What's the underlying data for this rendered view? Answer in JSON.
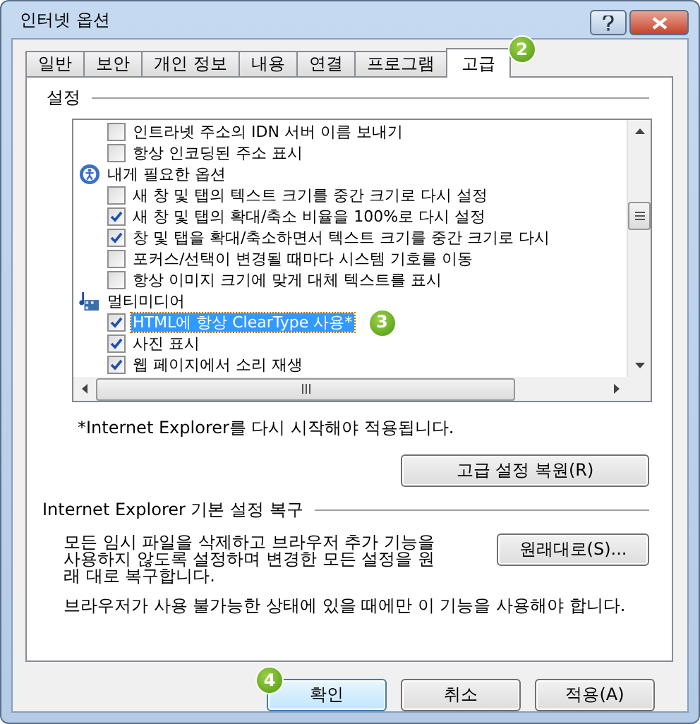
{
  "window": {
    "title": "인터넷 옵션"
  },
  "tabs": [
    {
      "label": "일반",
      "selected": false
    },
    {
      "label": "보안",
      "selected": false
    },
    {
      "label": "개인 정보",
      "selected": false
    },
    {
      "label": "내용",
      "selected": false
    },
    {
      "label": "연결",
      "selected": false
    },
    {
      "label": "프로그램",
      "selected": false
    },
    {
      "label": "고급",
      "selected": true,
      "badge": "2"
    }
  ],
  "settings": {
    "title": "설정",
    "items": [
      {
        "kind": "checkbox",
        "label": "인트라넷 주소의 IDN 서버 이름 보내기",
        "checked": false,
        "selected": false
      },
      {
        "kind": "checkbox",
        "label": "항상 인코딩된 주소 표시",
        "checked": false,
        "selected": false
      },
      {
        "kind": "group",
        "label": "내게 필요한 옵션"
      },
      {
        "kind": "checkbox",
        "label": "새 창 및 탭의 텍스트 크기를 중간 크기로 다시 설정",
        "checked": false,
        "selected": false
      },
      {
        "kind": "checkbox",
        "label": "새 창 및 탭의 확대/축소 비율을 100%로 다시 설정",
        "checked": true,
        "selected": false
      },
      {
        "kind": "checkbox",
        "label": "창 및 탭을 확대/축소하면서 텍스트 크기를 중간 크기로 다시",
        "checked": true,
        "selected": false
      },
      {
        "kind": "checkbox",
        "label": "포커스/선택이 변경될 때마다 시스템 기호를 이동",
        "checked": false,
        "selected": false
      },
      {
        "kind": "checkbox",
        "label": "항상 이미지 크기에 맞게 대체 텍스트를 표시",
        "checked": false,
        "selected": false
      },
      {
        "kind": "group",
        "label": "멀티미디어"
      },
      {
        "kind": "checkbox",
        "label": "HTML에 항상 ClearType 사용*",
        "checked": true,
        "selected": true,
        "badge": "3"
      },
      {
        "kind": "checkbox",
        "label": "사진 표시",
        "checked": true,
        "selected": false
      },
      {
        "kind": "checkbox",
        "label": "웹 페이지에서 소리 재생",
        "checked": true,
        "selected": false
      }
    ],
    "note": "*Internet Explorer를 다시 시작해야 적용됩니다.",
    "restore_button": "고급 설정 복원(R)"
  },
  "reset": {
    "title": "Internet Explorer 기본 설정 복구",
    "description": "모든 임시 파일을 삭제하고 브라우저 추가 기능을 사용하지 않도록 설정하며 변경한 모든 설정을 원래 대로 복구합니다.",
    "button": "원래대로(S)...",
    "warning": "브라우저가 사용 불가능한 상태에 있을 때에만 이 기능을 사용해야 합니다."
  },
  "buttons": [
    {
      "label": "확인",
      "default": true,
      "badge": "4"
    },
    {
      "label": "취소",
      "default": false
    },
    {
      "label": "적용(A)",
      "default": false
    }
  ]
}
